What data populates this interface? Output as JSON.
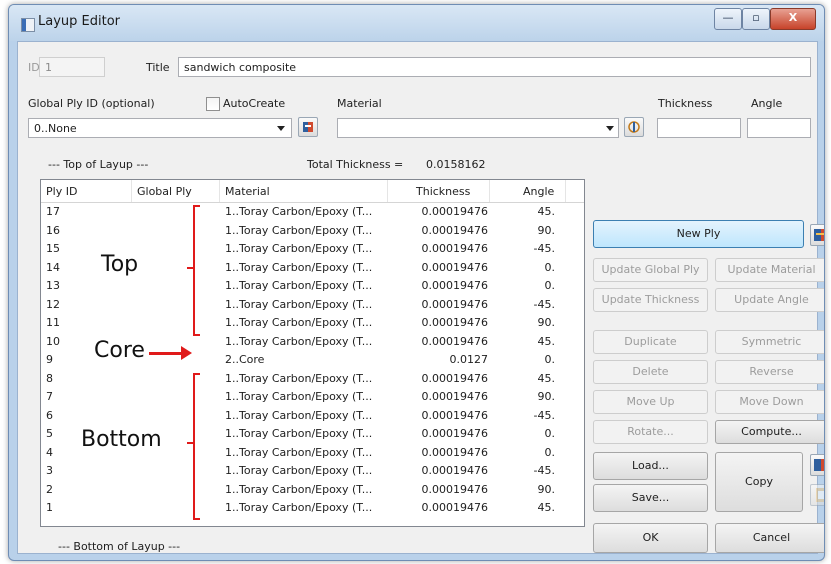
{
  "window": {
    "title": "Layup Editor",
    "minimize_symbol": "—",
    "maximize_symbol": "▫",
    "close_symbol": "X"
  },
  "top": {
    "id_label": "ID",
    "id_value": "1",
    "title_label": "Title",
    "title_value": "sandwich composite",
    "global_ply_label": "Global Ply ID (optional)",
    "global_ply_value": "0..None",
    "autocreate_label": "AutoCreate",
    "material_label": "Material",
    "material_value": "",
    "thickness_label": "Thickness",
    "thickness_value": "",
    "angle_label": "Angle",
    "angle_value": ""
  },
  "layup": {
    "top_label": "--- Top of Layup ---",
    "total_label": "Total Thickness =",
    "total_value": "0.0158162",
    "bottom_label": "--- Bottom of Layup ---",
    "columns": [
      "Ply ID",
      "Global Ply",
      "Material",
      "Thickness",
      "Angle"
    ],
    "rows": [
      {
        "ply": "17",
        "global": "",
        "material": "1..Toray Carbon/Epoxy (T...",
        "thickness": "0.00019476",
        "angle": "45."
      },
      {
        "ply": "16",
        "global": "",
        "material": "1..Toray Carbon/Epoxy (T...",
        "thickness": "0.00019476",
        "angle": "90."
      },
      {
        "ply": "15",
        "global": "",
        "material": "1..Toray Carbon/Epoxy (T...",
        "thickness": "0.00019476",
        "angle": "-45."
      },
      {
        "ply": "14",
        "global": "",
        "material": "1..Toray Carbon/Epoxy (T...",
        "thickness": "0.00019476",
        "angle": "0."
      },
      {
        "ply": "13",
        "global": "",
        "material": "1..Toray Carbon/Epoxy (T...",
        "thickness": "0.00019476",
        "angle": "0."
      },
      {
        "ply": "12",
        "global": "",
        "material": "1..Toray Carbon/Epoxy (T...",
        "thickness": "0.00019476",
        "angle": "-45."
      },
      {
        "ply": "11",
        "global": "",
        "material": "1..Toray Carbon/Epoxy (T...",
        "thickness": "0.00019476",
        "angle": "90."
      },
      {
        "ply": "10",
        "global": "",
        "material": "1..Toray Carbon/Epoxy (T...",
        "thickness": "0.00019476",
        "angle": "45."
      },
      {
        "ply": "9",
        "global": "",
        "material": "2..Core",
        "thickness": "0.0127",
        "angle": "0."
      },
      {
        "ply": "8",
        "global": "",
        "material": "1..Toray Carbon/Epoxy (T...",
        "thickness": "0.00019476",
        "angle": "45."
      },
      {
        "ply": "7",
        "global": "",
        "material": "1..Toray Carbon/Epoxy (T...",
        "thickness": "0.00019476",
        "angle": "90."
      },
      {
        "ply": "6",
        "global": "",
        "material": "1..Toray Carbon/Epoxy (T...",
        "thickness": "0.00019476",
        "angle": "-45."
      },
      {
        "ply": "5",
        "global": "",
        "material": "1..Toray Carbon/Epoxy (T...",
        "thickness": "0.00019476",
        "angle": "0."
      },
      {
        "ply": "4",
        "global": "",
        "material": "1..Toray Carbon/Epoxy (T...",
        "thickness": "0.00019476",
        "angle": "0."
      },
      {
        "ply": "3",
        "global": "",
        "material": "1..Toray Carbon/Epoxy (T...",
        "thickness": "0.00019476",
        "angle": "-45."
      },
      {
        "ply": "2",
        "global": "",
        "material": "1..Toray Carbon/Epoxy (T...",
        "thickness": "0.00019476",
        "angle": "90."
      },
      {
        "ply": "1",
        "global": "",
        "material": "1..Toray Carbon/Epoxy (T...",
        "thickness": "0.00019476",
        "angle": "45."
      }
    ]
  },
  "annotations": {
    "top": "Top",
    "core": "Core",
    "bottom": "Bottom"
  },
  "buttons": {
    "new_ply": "New Ply",
    "update_global_ply": "Update Global Ply",
    "update_material": "Update Material",
    "update_thickness": "Update Thickness",
    "update_angle": "Update Angle",
    "duplicate": "Duplicate",
    "symmetric": "Symmetric",
    "delete": "Delete",
    "reverse": "Reverse",
    "move_up": "Move Up",
    "move_down": "Move Down",
    "rotate": "Rotate...",
    "compute": "Compute...",
    "load": "Load...",
    "save": "Save...",
    "copy": "Copy",
    "ok": "OK",
    "cancel": "Cancel"
  },
  "colors": {
    "annotation_red": "#e01a1a",
    "titlebar_blue": "#bcd3ea",
    "primary_button_blue": "#bee6fd"
  },
  "icons": [
    "app-icon",
    "new-global-ply-icon",
    "material-browse-icon",
    "library-icon",
    "paste-icon"
  ]
}
